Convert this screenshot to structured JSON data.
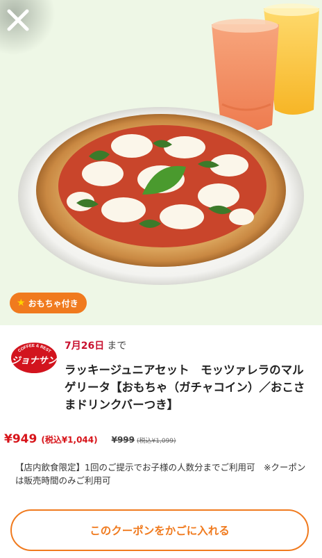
{
  "hero": {
    "image_alt": "pizza-margherita-with-juices",
    "tag": {
      "icon": "star-icon",
      "label": "おもちゃ付き"
    }
  },
  "brand": {
    "logo_icon": "jonathans-logo",
    "logo_text": "COFFEE & RESTAURANT ジョナサン"
  },
  "coupon": {
    "date": "7月26日",
    "until": "まで",
    "title": "ラッキージュニアセット　モッツァレラのマルゲリータ【おもちゃ（ガチャコイン）／おこさまドリンクバーつき】",
    "price": "¥949",
    "price_tax": "(税込¥1,044)",
    "old_price": "¥999",
    "old_price_tax": "(税込¥1,099)",
    "note": "【店内飲食限定】1回のご提示でお子様の人数分までご利用可　※クーポンは販売時間のみご利用可"
  },
  "cta": {
    "label": "このクーポンをかごに入れる"
  },
  "colors": {
    "accent": "#f07a1e",
    "price": "#d7141a",
    "date": "#c8102e"
  }
}
